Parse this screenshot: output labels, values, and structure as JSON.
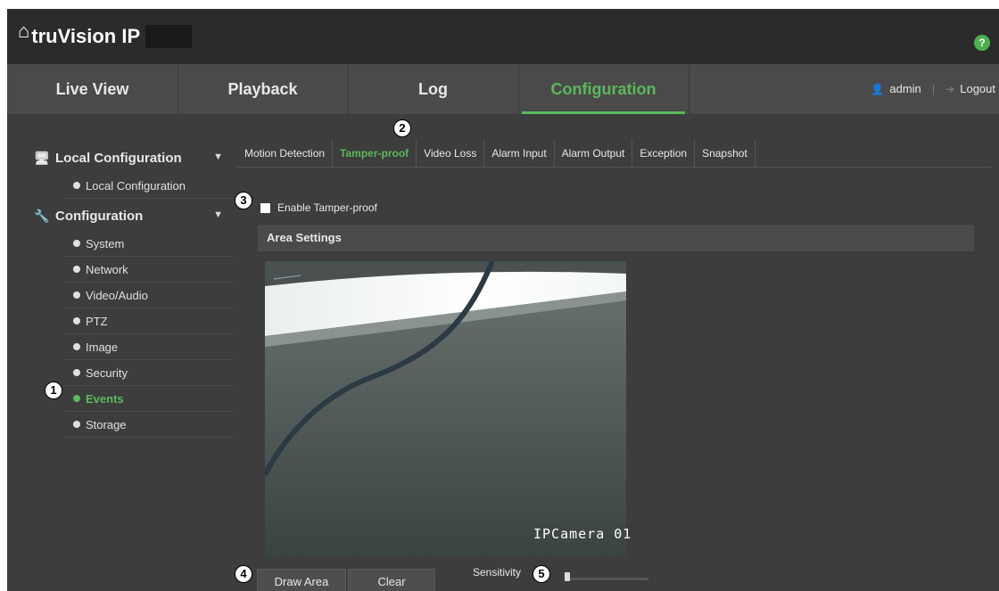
{
  "header": {
    "logo_text": "truVision IP",
    "help_label": "?"
  },
  "nav": {
    "tabs": [
      "Live View",
      "Playback",
      "Log",
      "Configuration"
    ],
    "active_tab": "Configuration",
    "user": "admin",
    "logout": "Logout"
  },
  "sidebar": {
    "local_section": "Local Configuration",
    "local_items": [
      "Local Configuration"
    ],
    "config_section": "Configuration",
    "config_items": [
      "System",
      "Network",
      "Video/Audio",
      "PTZ",
      "Image",
      "Security",
      "Events",
      "Storage"
    ],
    "active_item": "Events"
  },
  "subtabs": [
    "Motion Detection",
    "Tamper-proof",
    "Video Loss",
    "Alarm Input",
    "Alarm Output",
    "Exception",
    "Snapshot"
  ],
  "active_subtab": "Tamper-proof",
  "enable_label": "Enable Tamper-proof",
  "enable_checked": false,
  "area_settings_title": "Area Settings",
  "video_caption": "IPCamera 01",
  "buttons": {
    "draw_area": "Draw Area",
    "clear": "Clear"
  },
  "sensitivity_label": "Sensitivity",
  "sensitivity_level": 0,
  "markers": [
    "1",
    "2",
    "3",
    "4",
    "5"
  ],
  "colors": {
    "accent": "#5cb85c",
    "background": "#3d3d3d",
    "header": "#2b2b2b"
  }
}
